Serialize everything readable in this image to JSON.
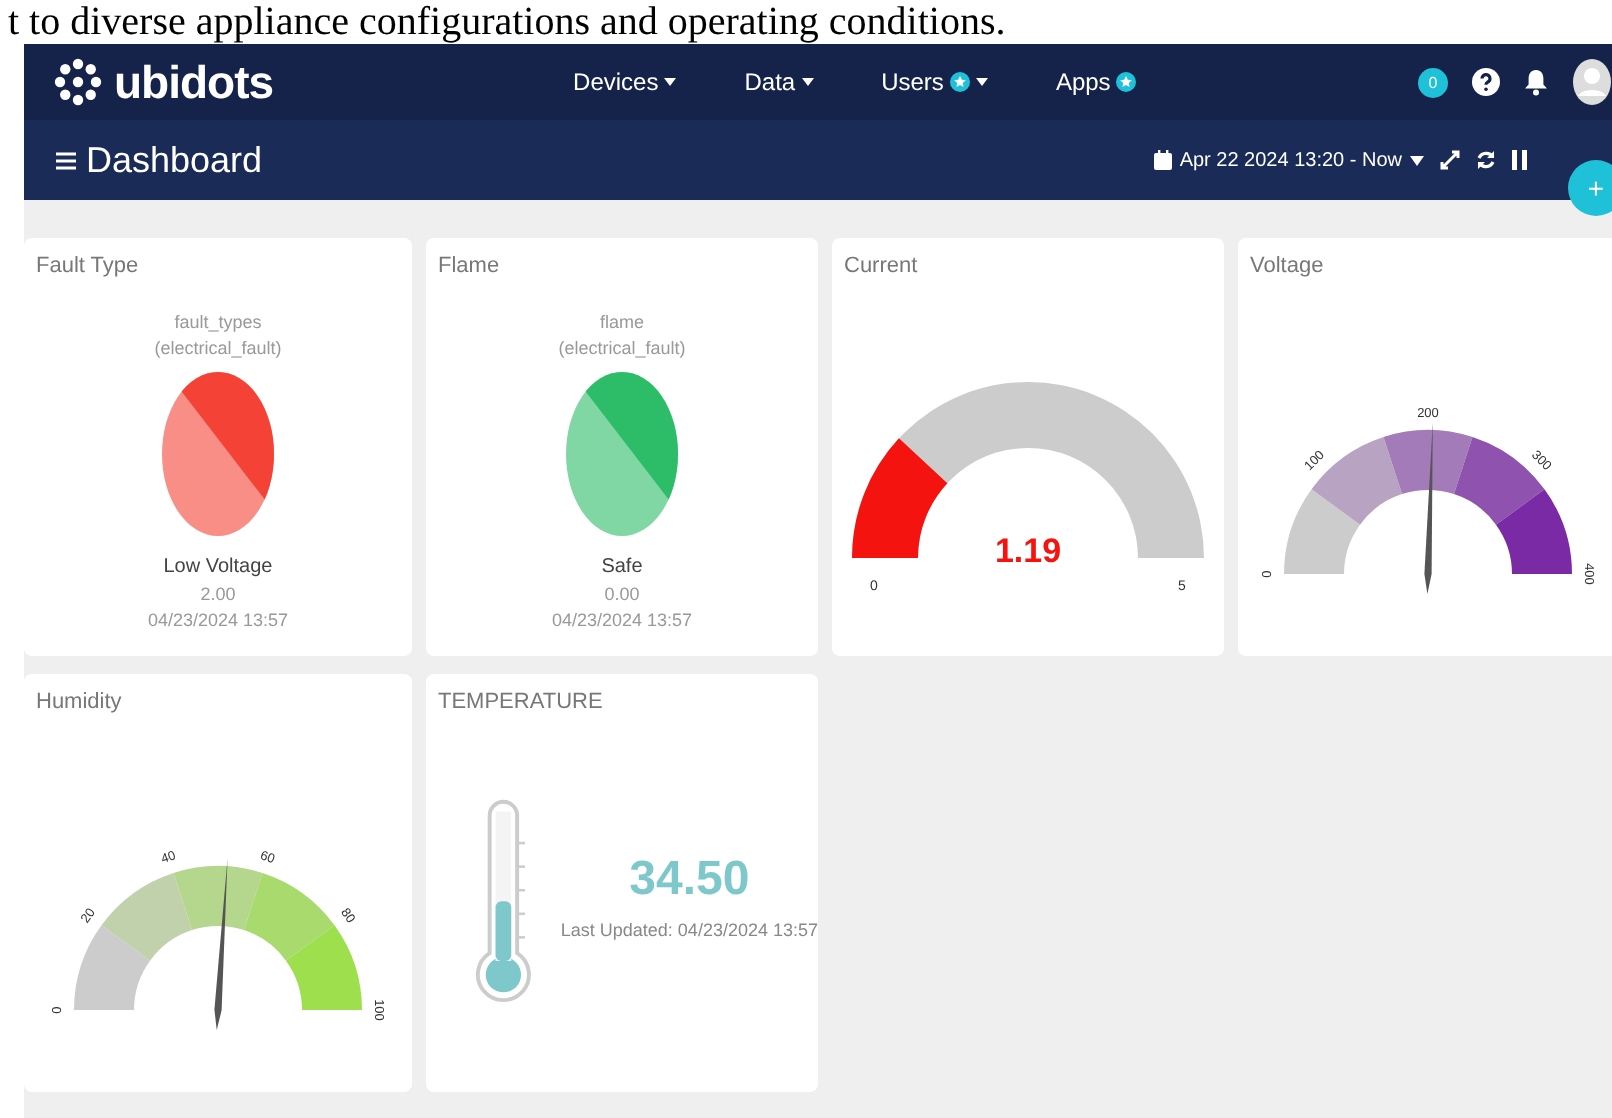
{
  "caption": "t to diverse appliance configurations and operating conditions.",
  "navbar": {
    "logo": "ubidots",
    "menu": [
      {
        "label": "Devices",
        "dropdown": true,
        "badge": false
      },
      {
        "label": "Data",
        "dropdown": true,
        "badge": false
      },
      {
        "label": "Users",
        "dropdown": true,
        "badge": true
      },
      {
        "label": "Apps",
        "dropdown": false,
        "badge": true
      }
    ],
    "notification_count": "0"
  },
  "header": {
    "title": "Dashboard",
    "date_range": "Apr 22 2024 13:20 - Now"
  },
  "add_button": "+",
  "widgets": [
    {
      "kind": "indicator",
      "title": "Fault Type",
      "variable": "fault_types",
      "device": "(electrical_fault)",
      "color": "#f44336",
      "state": "Low Voltage",
      "value": "2.00",
      "timestamp": "04/23/2024 13:57"
    },
    {
      "kind": "indicator",
      "title": "Flame",
      "variable": "flame",
      "device": "(electrical_fault)",
      "color": "#2dbd68",
      "state": "Safe",
      "value": "0.00",
      "timestamp": "04/23/2024 13:57"
    },
    {
      "kind": "arc",
      "title": "Current",
      "value": "1.19",
      "level": 0.238,
      "min": "0",
      "max": "5",
      "color": "#f5130f"
    },
    {
      "kind": "dial",
      "title": "Voltage",
      "level": 0.51,
      "ticks": [
        "0",
        "100",
        "200",
        "300",
        "400"
      ],
      "color": "#7b2aa5"
    },
    {
      "kind": "dial",
      "title": "Humidity",
      "level": 0.52,
      "ticks": [
        "0",
        "20",
        "40",
        "60",
        "80",
        "100"
      ],
      "color": "#9ddf4d"
    },
    {
      "kind": "thermometer",
      "title": "TEMPERATURE",
      "value": "34.50",
      "updated": "Last Updated: 04/23/2024 13:57",
      "level": 0.4
    }
  ]
}
